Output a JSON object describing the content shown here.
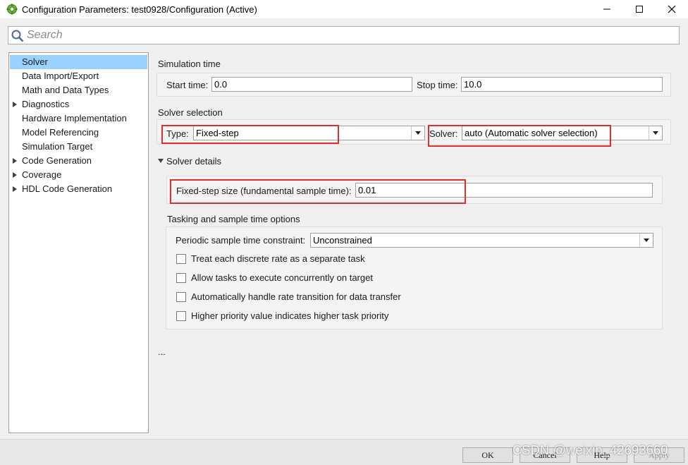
{
  "window": {
    "title": "Configuration Parameters: test0928/Configuration (Active)",
    "minimize": "—",
    "maximize": "☐",
    "close": "✕"
  },
  "search": {
    "placeholder": "Search"
  },
  "tree": {
    "items": [
      {
        "label": "Solver",
        "selected": true,
        "expandable": false
      },
      {
        "label": "Data Import/Export",
        "expandable": false
      },
      {
        "label": "Math and Data Types",
        "expandable": false
      },
      {
        "label": "Diagnostics",
        "expandable": true
      },
      {
        "label": "Hardware Implementation",
        "expandable": false
      },
      {
        "label": "Model Referencing",
        "expandable": false
      },
      {
        "label": "Simulation Target",
        "expandable": false
      },
      {
        "label": "Code Generation",
        "expandable": true
      },
      {
        "label": "Coverage",
        "expandable": true
      },
      {
        "label": "HDL Code Generation",
        "expandable": true
      }
    ]
  },
  "simulation_time": {
    "heading": "Simulation time",
    "start_label": "Start time:",
    "start_value": "0.0",
    "stop_label": "Stop time:",
    "stop_value": "10.0"
  },
  "solver_selection": {
    "heading": "Solver selection",
    "type_label": "Type:",
    "type_value": "Fixed-step",
    "solver_label": "Solver:",
    "solver_value": "auto (Automatic solver selection)"
  },
  "solver_details": {
    "heading": "Solver details",
    "step_label": "Fixed-step size (fundamental sample time):",
    "step_value": "0.01"
  },
  "tasking": {
    "heading": "Tasking and sample time options",
    "constraint_label": "Periodic sample time constraint:",
    "constraint_value": "Unconstrained",
    "checkboxes": [
      "Treat each discrete rate as a separate task",
      "Allow tasks to execute concurrently on target",
      "Automatically handle rate transition for data transfer",
      "Higher priority value indicates higher task priority"
    ]
  },
  "ellipsis": "...",
  "buttons": {
    "ok": "OK",
    "cancel": "Cancel",
    "help": "Help",
    "apply": "Apply"
  },
  "watermark": "CSDN @weixin_42693660",
  "colors": {
    "selection": "#99d1ff",
    "highlight": "#e02f2f"
  }
}
